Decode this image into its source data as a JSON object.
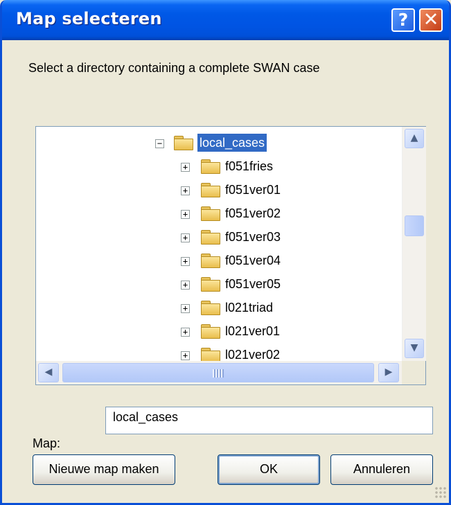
{
  "window": {
    "title": "Map selecteren",
    "help_glyph": "?",
    "close_glyph": "✕"
  },
  "prompt": "Select a directory containing a complete SWAN case",
  "tree": {
    "items": [
      {
        "label": "local_cases",
        "expander": "−",
        "selected": true
      },
      {
        "label": "f051fries",
        "expander": "+"
      },
      {
        "label": "f051ver01",
        "expander": "+"
      },
      {
        "label": "f051ver02",
        "expander": "+"
      },
      {
        "label": "f051ver03",
        "expander": "+"
      },
      {
        "label": "f051ver04",
        "expander": "+"
      },
      {
        "label": "f051ver05",
        "expander": "+"
      },
      {
        "label": "l021triad",
        "expander": "+"
      },
      {
        "label": "l021ver01",
        "expander": "+"
      },
      {
        "label": "l021ver02",
        "expander": "+"
      }
    ],
    "scroll_up_glyph": "▲",
    "scroll_down_glyph": "▼",
    "scroll_left_glyph": "◀",
    "scroll_right_glyph": "▶"
  },
  "map": {
    "label": "Map:",
    "value": "local_cases"
  },
  "buttons": {
    "new_folder": "Nieuwe map maken",
    "ok": "OK",
    "cancel": "Annuleren"
  },
  "icons": {
    "folder": "folder-icon",
    "help": "help-icon",
    "close": "close-icon"
  }
}
